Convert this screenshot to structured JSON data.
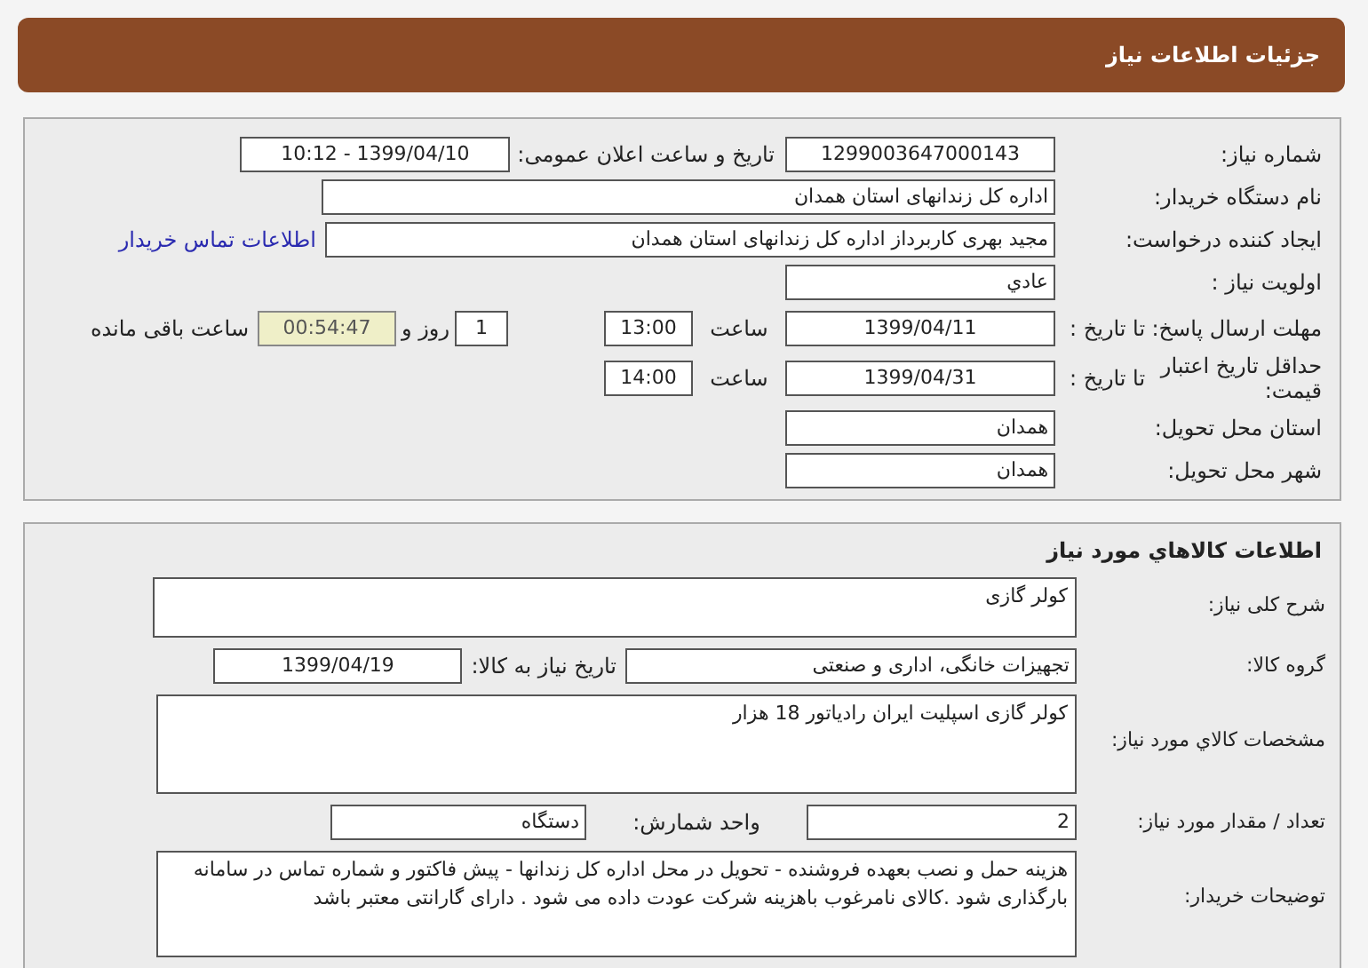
{
  "header": {
    "title": "جزئیات اطلاعات نیاز"
  },
  "need": {
    "number_label": "شماره نیاز:",
    "number": "1299003647000143",
    "announce_label": "تاریخ و ساعت اعلان عمومی:",
    "announce": "1399/04/10 - 10:12",
    "buyer_label": "نام دستگاه خریدار:",
    "buyer": "اداره کل زندانهای استان همدان",
    "creator_label": "ایجاد کننده درخواست:",
    "creator": "مجید بهری کاربرداز اداره کل زندانهای استان همدان",
    "contact_link": "اطلاعات تماس خریدار",
    "priority_label": "اولویت نیاز :",
    "priority": "عادي",
    "deadline_label": "مهلت ارسال پاسخ:",
    "deadline_to": "تا تاریخ :",
    "deadline_date": "1399/04/11",
    "deadline_time_label": "ساعت",
    "deadline_time": "13:00",
    "days": "1",
    "days_label": "روز و",
    "remaining": "00:54:47",
    "remaining_label": "ساعت باقی مانده",
    "validity_label": "حداقل تاریخ اعتبار قیمت:",
    "validity_to": "تا تاریخ :",
    "validity_date": "1399/04/31",
    "validity_time_label": "ساعت",
    "validity_time": "14:00",
    "province_label": "استان محل تحویل:",
    "province": "همدان",
    "city_label": "شهر محل تحویل:",
    "city": "همدان"
  },
  "goods": {
    "heading": "اطلاعات کالاهاي مورد نیاز",
    "summary_label": "شرح کلی نیاز:",
    "summary": "کولر گازی",
    "group_label": "گروه کالا:",
    "group": "تجهیزات خانگی، اداری و صنعتی",
    "need_date_label": "تاریخ نیاز به کالا:",
    "need_date": "1399/04/19",
    "spec_label": "مشخصات کالاي مورد نیاز:",
    "spec": "کولر گازی اسپلیت ایران رادیاتور 18 هزار",
    "qty_label": "تعداد / مقدار مورد نیاز:",
    "qty": "2",
    "unit_label": "واحد شمارش:",
    "unit": "دستگاه",
    "notes_label": "توضیحات خریدار:",
    "notes": "هزینه حمل و نصب بعهده فروشنده - تحویل در محل اداره کل زندانها - پیش فاکتور و شماره تماس در سامانه بارگذاری شود .کالای نامرغوب باهزینه شرکت عودت داده می شود . دارای گارانتی معتبر باشد"
  }
}
